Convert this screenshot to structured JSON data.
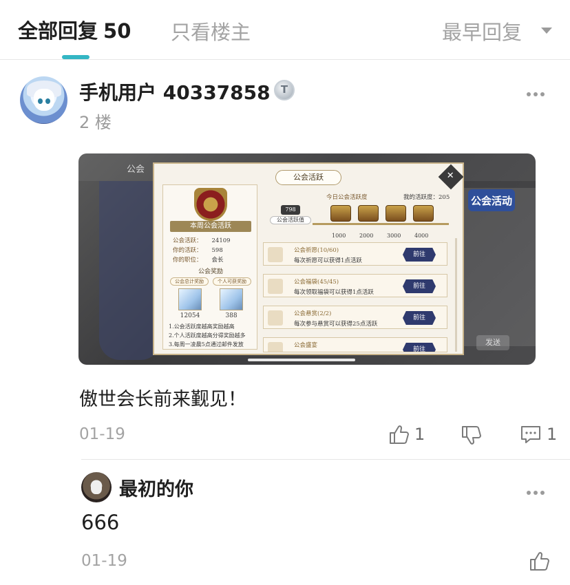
{
  "tabs": {
    "all_label": "全部回复",
    "all_count": "50",
    "owner_only_label": "只看楼主",
    "sort_label": "最早回复"
  },
  "post": {
    "username": "手机用户 40337858",
    "badge": "T",
    "floor": "2 楼",
    "text": "傲世会长前来觐见！",
    "date": "01-19",
    "like_count": "1",
    "comment_count": "1",
    "screenshot": {
      "guild_label": "公会",
      "activity_tag": "公会活动",
      "send_label": "发送",
      "panel_title": "公会活跃",
      "close_label": "✕",
      "weekly_title": "本周公会活跃",
      "stats": [
        {
          "label": "公会活跃：",
          "value": "24109"
        },
        {
          "label": "你的活跃：",
          "value": "598"
        },
        {
          "label": "你的职位：",
          "value": "会长"
        }
      ],
      "reward_header": "公会奖励",
      "reward_tags": [
        "公会总计奖励",
        "个人可获奖励"
      ],
      "gem_values": [
        "12054",
        "388"
      ],
      "rules": [
        "1.公会活跃度越高奖励越高",
        "2.个人活跃度越高分得奖励越多",
        "3.每周一凌晨5点通过邮件发放"
      ],
      "today_label": "今日公会活跃度",
      "my_activity": "我的活跃度：205",
      "activity_value_label": "公会活跃值",
      "activity_number": "798",
      "ticks": [
        "1000",
        "2000",
        "3000",
        "4000"
      ],
      "tasks": [
        {
          "name": "公会祈愿(10/60)",
          "desc": "每次祈愿可以获得1点活跃",
          "button": "前往"
        },
        {
          "name": "公会福袋(45/45)",
          "desc": "每次领取福袋可以获得1点活跃",
          "button": "前往"
        },
        {
          "name": "公会悬赏(2/2)",
          "desc": "每次参与悬赏可以获得25点活跃",
          "button": "前往"
        },
        {
          "name": "公会盛宴",
          "desc": "",
          "button": "前往"
        }
      ]
    }
  },
  "reply": {
    "username": "最初的你",
    "text": "666",
    "date": "01-19"
  },
  "colors": {
    "accent": "#34b6c4",
    "muted": "#a3a3a3",
    "text": "#1f1f1f"
  }
}
